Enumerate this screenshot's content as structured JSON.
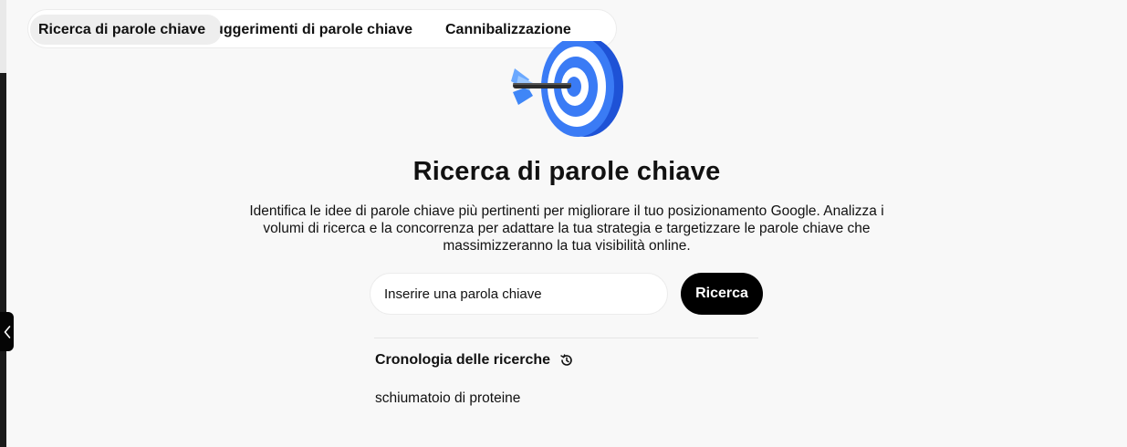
{
  "tabs": [
    {
      "label": "Ricerca di parole chiave",
      "active": true
    },
    {
      "label": "Suggerimenti di parole chiave",
      "active": false
    },
    {
      "label": "Cannibalizzazione",
      "active": false
    }
  ],
  "main": {
    "title": "Ricerca di parole chiave",
    "description": "Identifica le idee di parole chiave più pertinenti per migliorare il tuo posizionamento Google. Analizza i volumi di ricerca e la concorrenza per adattare la tua strategia e targetizzare le parole chiave che massimizzeranno la tua visibilità online.",
    "icon": "target-with-arrow-icon"
  },
  "search": {
    "placeholder": "Inserire una parola chiave",
    "value": "",
    "button_label": "Ricerca"
  },
  "history": {
    "title": "Cronologia delle ricerche",
    "icon": "history-icon",
    "items": [
      "schiumatoio di proteine"
    ]
  },
  "colors": {
    "accent_blue": "#2f6ff0",
    "button_bg": "#000000",
    "page_bg": "#f8f8f8"
  }
}
